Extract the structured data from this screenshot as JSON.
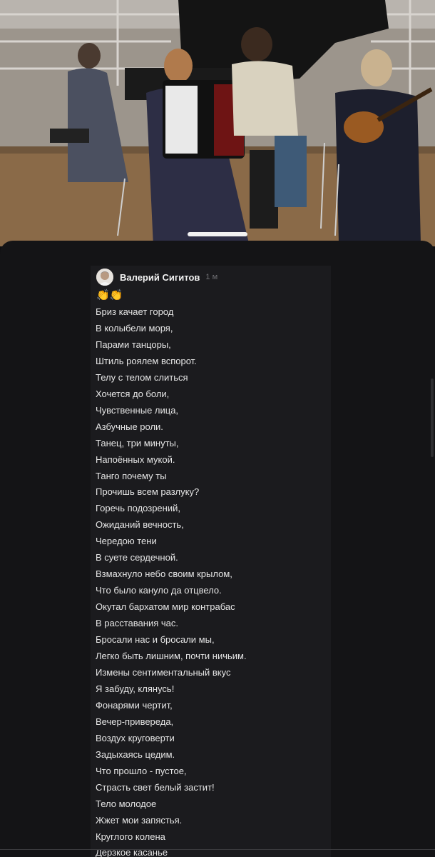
{
  "comment": {
    "author": "Валерий Сигитов",
    "time": "1 м",
    "emoji": "👏👏",
    "lines": [
      "Бриз качает город",
      "В колыбели моря,",
      "Парами танцоры,",
      "Штиль роялем вспорот.",
      "Телу с телом слиться",
      "Хочется до боли,",
      "Чувственные лица,",
      "Азбучные роли.",
      "Танец, три минуты,",
      "Напоённых мукой.",
      "Танго почему ты",
      "Прочишь всем разлуку?",
      "Горечь подозрений,",
      "Ожиданий вечность,",
      "Чередою тени",
      "В суете сердечной.",
      "Взмахнуло небо своим крылом,",
      "Что было кануло да отцвело.",
      "Окутал бархатом мир контрабас",
      "В расставания час.",
      "Бросали нас и бросали мы,",
      "Легко быть лишним, почти ничьим.",
      "Измены сентиментальный вкус",
      "Я забуду, клянусь!",
      "Фонарями чертит,",
      "Вечер-привереда,",
      "Воздух круговерти",
      "Задыхаясь цедим.",
      "Что прошло - пустое,",
      "Страсть свет белый застит!",
      "Тело молодое",
      "Жжет мои запястья.",
      "Круглого колена",
      "Дерзкое касанье"
    ]
  }
}
